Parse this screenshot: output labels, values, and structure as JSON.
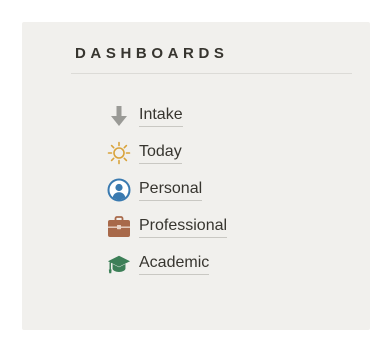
{
  "panel": {
    "heading": "DASHBOARDS"
  },
  "dashboards": {
    "items": [
      {
        "label": "Intake",
        "icon": "down-arrow-icon",
        "color": "#9a9a96"
      },
      {
        "label": "Today",
        "icon": "sun-icon",
        "color": "#d9a33b"
      },
      {
        "label": "Personal",
        "icon": "user-circle-icon",
        "color": "#3a7ab0"
      },
      {
        "label": "Professional",
        "icon": "briefcase-icon",
        "color": "#a8694a"
      },
      {
        "label": "Academic",
        "icon": "graduation-cap-icon",
        "color": "#3c7f57"
      }
    ]
  }
}
